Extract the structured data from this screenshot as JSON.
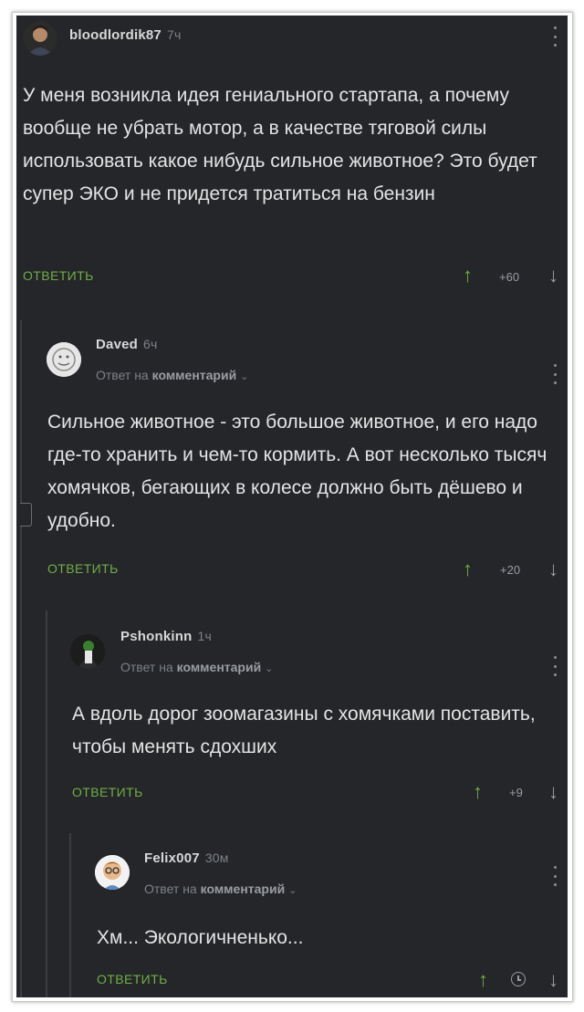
{
  "comments": [
    {
      "author": "bloodlordik87",
      "time": "7ч",
      "text": "У меня возникла идея гениального стартапа, а почему вообще не убрать мотор, а в качестве тяговой силы использовать какое нибудь сильное животное? Это будет супер ЭКО и не придется тратиться на бензин",
      "reply_label": "ОТВЕТИТЬ",
      "rating": "+60"
    },
    {
      "author": "Daved",
      "time": "6ч",
      "reply_to_prefix": "Ответ на",
      "reply_to_target": "комментарий",
      "text": "Сильное животное - это большое животное, и его надо где-то хранить и чем-то кормить. А вот несколько тысяч хомячков, бегающих в колесе должно быть дёшево и удобно.",
      "reply_label": "ОТВЕТИТЬ",
      "rating": "+20"
    },
    {
      "author": "Pshonkinn",
      "time": "1ч",
      "reply_to_prefix": "Ответ на",
      "reply_to_target": "комментарий",
      "text": "А вдоль дорог зоомагазины с хомячками поставить, чтобы менять сдохших",
      "reply_label": "ОТВЕТИТЬ",
      "rating": "+9"
    },
    {
      "author": "Felix007",
      "time": "30м",
      "reply_to_prefix": "Ответ на",
      "reply_to_target": "комментарий",
      "text": "Хм... Экологичненько...",
      "reply_label": "ОТВЕТИТЬ",
      "rating": ""
    }
  ],
  "icons": {
    "up": "up-arrow-icon",
    "down": "down-arrow-icon",
    "menu": "more-vertical-icon",
    "chevron": "chevron-down-icon",
    "pending": "clock-icon"
  },
  "colors": {
    "background": "#24262a",
    "accent_green": "#6fae45",
    "text": "#e4e4e4",
    "muted": "#7d8086"
  }
}
